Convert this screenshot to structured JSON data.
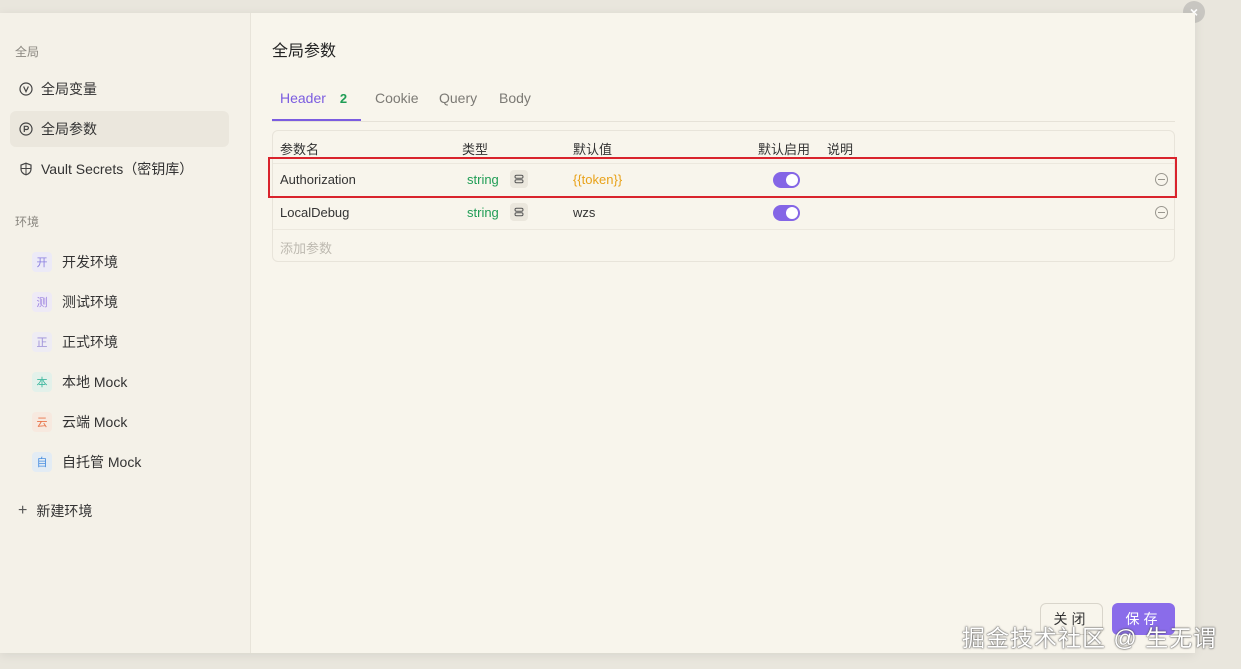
{
  "window": {
    "close_glyph": "×"
  },
  "sidebar": {
    "global_label": "全局",
    "global_items": [
      {
        "label": "全局变量",
        "icon": "variable-icon",
        "active": false
      },
      {
        "label": "全局参数",
        "icon": "parameter-icon",
        "active": true
      },
      {
        "label": "Vault Secrets（密钥库）",
        "icon": "shield-icon",
        "active": false
      }
    ],
    "env_label": "环境",
    "environments": [
      {
        "badge": "开",
        "label": "开发环境",
        "color": "#8a7fe0",
        "bg": "#eceaf7"
      },
      {
        "badge": "测",
        "label": "测试环境",
        "color": "#9a7fe0",
        "bg": "#eeeaf6"
      },
      {
        "badge": "正",
        "label": "正式环境",
        "color": "#9b8ed8",
        "bg": "#eeecf4"
      },
      {
        "badge": "本",
        "label": "本地 Mock",
        "color": "#3fb8a0",
        "bg": "#e3f1ea"
      },
      {
        "badge": "云",
        "label": "云端 Mock",
        "color": "#e8744a",
        "bg": "#f7e9df"
      },
      {
        "badge": "自",
        "label": "自托管 Mock",
        "color": "#4a8fe0",
        "bg": "#e3ecf4"
      }
    ],
    "new_env_label": "新建环境"
  },
  "main": {
    "title": "全局参数",
    "tabs": [
      {
        "label": "Header",
        "count": "2",
        "active": true
      },
      {
        "label": "Cookie"
      },
      {
        "label": "Query"
      },
      {
        "label": "Body"
      }
    ],
    "table": {
      "columns": [
        "参数名",
        "类型",
        "默认值",
        "默认启用",
        "说明"
      ],
      "rows": [
        {
          "name": "Authorization",
          "type": "string",
          "value": "{{token}}",
          "enabled": true,
          "description": ""
        },
        {
          "name": "LocalDebug",
          "type": "string",
          "value": "wzs",
          "enabled": true,
          "description": ""
        }
      ],
      "add_placeholder": "添加参数"
    },
    "buttons": {
      "close": "关闭",
      "save": "保存"
    }
  },
  "watermark": "掘金技术社区 @ 生无谓",
  "colors": {
    "accent": "#7b5ce0",
    "type_green": "#1f9d55",
    "var_orange": "#e8a21a",
    "highlight_red": "#d9232c"
  }
}
